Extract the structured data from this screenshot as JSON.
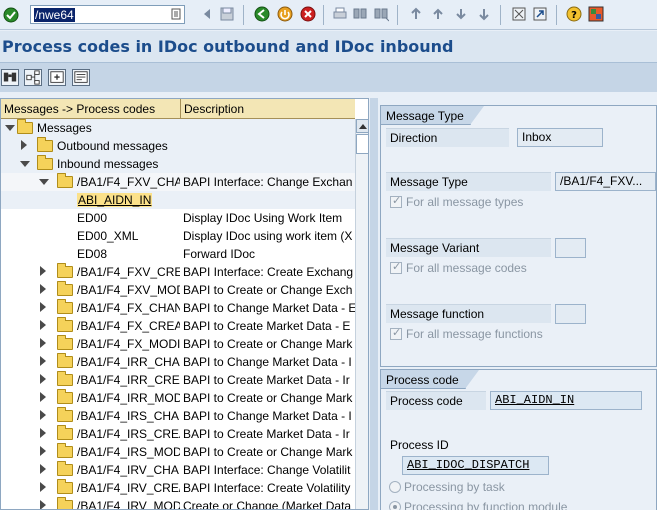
{
  "toolbar": {
    "command_field": "/nwe64",
    "icons": [
      "enter-icon",
      "save-icon",
      "back-icon",
      "exit-icon",
      "cancel-icon",
      "print-icon",
      "find-icon",
      "find-next-icon",
      "first-page-icon",
      "previous-page-icon",
      "next-page-icon",
      "last-page-icon",
      "create-session-icon",
      "shortcut-icon",
      "help-icon",
      "layout-icon"
    ]
  },
  "title": "Process codes in IDoc outbound and IDoc inbound",
  "app_toolbar": {
    "icons": [
      "binoculars-icon",
      "hierarchy-icon",
      "expand-subtree-icon",
      "display-icon"
    ]
  },
  "tree": {
    "col_header_1": "Messages -> Process codes",
    "col_header_2": "Description",
    "rows": [
      {
        "label": "Messages",
        "desc": ""
      },
      {
        "label": "Outbound messages",
        "desc": ""
      },
      {
        "label": "Inbound messages",
        "desc": ""
      },
      {
        "label": "/BA1/F4_FXV_CHA",
        "desc": "BAPI Interface: Change Exchan"
      },
      {
        "label": "ABI_AIDN_IN",
        "desc": ""
      },
      {
        "label": "ED00",
        "desc": "Display IDoc Using Work Item"
      },
      {
        "label": "ED00_XML",
        "desc": "Display IDoc using work item (X"
      },
      {
        "label": "ED08",
        "desc": "Forward IDoc"
      },
      {
        "label": "/BA1/F4_FXV_CREA",
        "desc": "BAPI Interface: Create Exchang"
      },
      {
        "label": "/BA1/F4_FXV_MOD",
        "desc": "BAPI to Create or Change Exch"
      },
      {
        "label": "/BA1/F4_FX_CHAN",
        "desc": "BAPI to Change Market Data - E"
      },
      {
        "label": "/BA1/F4_FX_CREA",
        "desc": "BAPI to Create Market Data - E"
      },
      {
        "label": "/BA1/F4_FX_MODI",
        "desc": "BAPI to Create or Change Mark"
      },
      {
        "label": "/BA1/F4_IRR_CHAI",
        "desc": "BAPI to Change Market Data - I"
      },
      {
        "label": "/BA1/F4_IRR_CREA",
        "desc": "BAPI to Create Market Data - Ir"
      },
      {
        "label": "/BA1/F4_IRR_MOD",
        "desc": "BAPI to Create or Change Mark"
      },
      {
        "label": "/BA1/F4_IRS_CHAI",
        "desc": "BAPI to Change Market Data - I"
      },
      {
        "label": "/BA1/F4_IRS_CREA",
        "desc": "BAPI to Create Market Data - Ir"
      },
      {
        "label": "/BA1/F4_IRS_MOD",
        "desc": "BAPI to Create or Change Mark"
      },
      {
        "label": "/BA1/F4_IRV_CHA",
        "desc": "BAPI Interface: Change Volatilit"
      },
      {
        "label": "/BA1/F4_IRV_CRE/",
        "desc": "BAPI Interface: Create Volatility"
      },
      {
        "label": "/BA1/F4_IRV_MOD",
        "desc": "Create or Change (Market Data"
      }
    ]
  },
  "message_type": {
    "group_title": "Message Type",
    "direction_label": "Direction",
    "direction_value": "Inbox",
    "msgtype_label": "Message Type",
    "msgtype_value": "/BA1/F4_FXV...",
    "all_msgtypes": "For all message types",
    "variant_label": "Message Variant",
    "variant_value": "",
    "all_msgcodes": "For all message codes",
    "function_label": "Message function",
    "function_value": "",
    "all_msgfunctions": "For all message functions"
  },
  "process_code": {
    "group_title": "Process code",
    "code_label": "Process code",
    "code_value": "ABI_AIDN_IN",
    "id_label": "Process ID",
    "id_value": "ABI_IDOC_DISPATCH",
    "radio_task": "Processing by task",
    "radio_fm": "Processing by function module"
  }
}
